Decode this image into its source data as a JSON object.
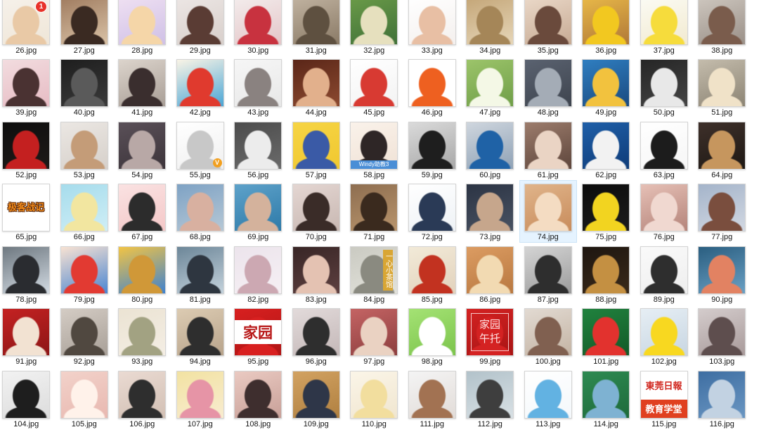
{
  "items": [
    {
      "name": "26.jpg",
      "colors": [
        "#f6f1ea",
        "#e9c9a6",
        "#efe6d8"
      ],
      "overlay": {
        "style": "badge",
        "lines": [
          "1"
        ]
      }
    },
    {
      "name": "27.jpg",
      "colors": [
        "#a07c60",
        "#3a2a22",
        "#d9c2a6"
      ]
    },
    {
      "name": "28.jpg",
      "colors": [
        "#efe0f2",
        "#f5d6a8",
        "#cfc0e6"
      ]
    },
    {
      "name": "29.jpg",
      "colors": [
        "#ece6e4",
        "#5a3c34",
        "#d8cfcb"
      ]
    },
    {
      "name": "30.jpg",
      "colors": [
        "#f3ecec",
        "#c8323f",
        "#e4c6c8"
      ]
    },
    {
      "name": "31.jpg",
      "colors": [
        "#c0b2a0",
        "#5e5040",
        "#8a7a66"
      ]
    },
    {
      "name": "32.jpg",
      "colors": [
        "#6a9a48",
        "#e6e0be",
        "#3f7038"
      ]
    },
    {
      "name": "33.jpg",
      "colors": [
        "#ffffff",
        "#e8bfa4",
        "#f4f0ee"
      ]
    },
    {
      "name": "34.jpg",
      "colors": [
        "#c4a678",
        "#a58658",
        "#e6d6b8"
      ]
    },
    {
      "name": "35.jpg",
      "colors": [
        "#ead8c8",
        "#6a4a3c",
        "#c7ab94"
      ]
    },
    {
      "name": "36.jpg",
      "colors": [
        "#e8b848",
        "#f2c820",
        "#b07838"
      ]
    },
    {
      "name": "37.jpg",
      "colors": [
        "#fbfbf4",
        "#f6dc3c",
        "#f2ead0"
      ]
    },
    {
      "name": "38.jpg",
      "colors": [
        "#cdc6be",
        "#7a5c4c",
        "#9a9088"
      ]
    },
    {
      "name": "39.jpg",
      "colors": [
        "#f2dcdf",
        "#4a3232",
        "#e7bcc4"
      ]
    },
    {
      "name": "40.jpg",
      "colors": [
        "#1e1e1e",
        "#5a5a5a",
        "#3a3a3a"
      ]
    },
    {
      "name": "41.jpg",
      "colors": [
        "#dcd4cc",
        "#3a2e2e",
        "#a89e96"
      ]
    },
    {
      "name": "42.jpg",
      "colors": [
        "#faf4e6",
        "#e03a2e",
        "#4aa6d6"
      ]
    },
    {
      "name": "43.jpg",
      "colors": [
        "#f6f6f6",
        "#8a8280",
        "#e8e8e8"
      ]
    },
    {
      "name": "44.jpg",
      "colors": [
        "#5a2618",
        "#e2b08c",
        "#8c4a30"
      ]
    },
    {
      "name": "45.jpg",
      "colors": [
        "#ffffff",
        "#d83a32",
        "#f3f3f3"
      ]
    },
    {
      "name": "46.jpg",
      "colors": [
        "#ffffff",
        "#ee6020",
        "#ffffff"
      ]
    },
    {
      "name": "47.jpg",
      "colors": [
        "#9cc46a",
        "#f4f8e6",
        "#6f9e48"
      ]
    },
    {
      "name": "48.jpg",
      "colors": [
        "#5a6270",
        "#a4acb6",
        "#3e444e"
      ]
    },
    {
      "name": "49.jpg",
      "colors": [
        "#2f7ec0",
        "#f2c23e",
        "#1a4a80"
      ]
    },
    {
      "name": "50.jpg",
      "colors": [
        "#262626",
        "#e8e8e8",
        "#444444"
      ]
    },
    {
      "name": "51.jpg",
      "colors": [
        "#c4bcac",
        "#f0e2c8",
        "#8c8474"
      ]
    },
    {
      "name": "52.jpg",
      "colors": [
        "#0e0e0e",
        "#c42020",
        "#1e1a18"
      ]
    },
    {
      "name": "53.jpg",
      "colors": [
        "#ebe7e3",
        "#c49c78",
        "#d6d0ca"
      ]
    },
    {
      "name": "54.jpg",
      "colors": [
        "#5a5058",
        "#b8a8a6",
        "#3c343a"
      ]
    },
    {
      "name": "55.jpg",
      "colors": [
        "#ffffff",
        "#c8c8c8",
        "#f0f0f0"
      ],
      "overlay": {
        "style": "badge-v",
        "lines": [
          "V"
        ]
      }
    },
    {
      "name": "56.jpg",
      "colors": [
        "#4c4c4c",
        "#ececec",
        "#6a6a6a"
      ]
    },
    {
      "name": "57.jpg",
      "colors": [
        "#f6d444",
        "#3a5aa6",
        "#f0c830"
      ]
    },
    {
      "name": "58.jpg",
      "colors": [
        "#faf2ea",
        "#2e2626",
        "#f0e2d6"
      ],
      "overlay": {
        "style": "caption",
        "lines": [
          "Windy助教3"
        ]
      }
    },
    {
      "name": "59.jpg",
      "colors": [
        "#dadada",
        "#1e1e1e",
        "#a8a8a8"
      ]
    },
    {
      "name": "60.jpg",
      "colors": [
        "#cfd6de",
        "#1f62a6",
        "#8fa2b6"
      ]
    },
    {
      "name": "61.jpg",
      "colors": [
        "#9c7c6c",
        "#ead4c4",
        "#5e463c"
      ]
    },
    {
      "name": "62.jpg",
      "colors": [
        "#1f5fa8",
        "#f2f2f2",
        "#0f3c78"
      ]
    },
    {
      "name": "63.jpg",
      "colors": [
        "#ffffff",
        "#1c1c1c",
        "#f6f6f6"
      ]
    },
    {
      "name": "64.jpg",
      "colors": [
        "#3e302a",
        "#c6965e",
        "#1e1814"
      ]
    },
    {
      "name": "65.jpg",
      "colors": [
        "#ffffff",
        "#ffffff",
        "#ffffff"
      ],
      "overlay": {
        "style": "title",
        "lines": [
          "极客战记"
        ]
      }
    },
    {
      "name": "66.jpg",
      "colors": [
        "#a6dcec",
        "#f2e6a0",
        "#cfeef6"
      ]
    },
    {
      "name": "67.jpg",
      "colors": [
        "#fae2e2",
        "#2c2c2c",
        "#f4c8c8"
      ]
    },
    {
      "name": "68.jpg",
      "colors": [
        "#7ea2c4",
        "#d8b0a0",
        "#b6c8d6"
      ]
    },
    {
      "name": "69.jpg",
      "colors": [
        "#5ea2ca",
        "#d4b29c",
        "#2e7aa8"
      ]
    },
    {
      "name": "70.jpg",
      "colors": [
        "#e4d6d2",
        "#3a2c28",
        "#c8b8b2"
      ]
    },
    {
      "name": "71.jpg",
      "colors": [
        "#8e6e50",
        "#3a2a1e",
        "#b8946c"
      ]
    },
    {
      "name": "72.jpg",
      "colors": [
        "#ffffff",
        "#2a3a56",
        "#eef2f6"
      ]
    },
    {
      "name": "73.jpg",
      "colors": [
        "#2c3444",
        "#c6a68c",
        "#485262"
      ]
    },
    {
      "name": "74.jpg",
      "colors": [
        "#e0b48a",
        "#f4dcc2",
        "#c88c5c"
      ],
      "hovered": true
    },
    {
      "name": "75.jpg",
      "colors": [
        "#0c0c0c",
        "#f2d420",
        "#1c1c1c"
      ]
    },
    {
      "name": "76.jpg",
      "colors": [
        "#e6c0b6",
        "#f0d8d0",
        "#b4847a"
      ]
    },
    {
      "name": "77.jpg",
      "colors": [
        "#a4b4ca",
        "#7a4e3e",
        "#d2d8e2"
      ]
    },
    {
      "name": "78.jpg",
      "colors": [
        "#6e7880",
        "#2a2c30",
        "#d2dae2"
      ]
    },
    {
      "name": "79.jpg",
      "colors": [
        "#f8e2d2",
        "#e23a32",
        "#4a86d2"
      ]
    },
    {
      "name": "80.jpg",
      "colors": [
        "#f2c444",
        "#d09838",
        "#3e82d0"
      ]
    },
    {
      "name": "81.jpg",
      "colors": [
        "#6c8698",
        "#2e3640",
        "#c4d2dc"
      ]
    },
    {
      "name": "82.jpg",
      "colors": [
        "#ece4ec",
        "#cca8b2",
        "#f6f0f4"
      ]
    },
    {
      "name": "83.jpg",
      "colors": [
        "#382626",
        "#e4c2b2",
        "#5e4040"
      ]
    },
    {
      "name": "84.jpg",
      "colors": [
        "#cacac2",
        "#8a8a80",
        "#e2e2da"
      ],
      "overlay": {
        "style": "vertical",
        "lines": [
          "一心小茶馆"
        ]
      }
    },
    {
      "name": "85.jpg",
      "colors": [
        "#f2ead8",
        "#c23220",
        "#e2d2bc"
      ]
    },
    {
      "name": "86.jpg",
      "colors": [
        "#dc9c62",
        "#f2dab2",
        "#b87840"
      ]
    },
    {
      "name": "87.jpg",
      "colors": [
        "#d4d4d4",
        "#2e2e2e",
        "#9c9c9c"
      ]
    },
    {
      "name": "88.jpg",
      "colors": [
        "#1e1610",
        "#c49042",
        "#3a2a1a"
      ]
    },
    {
      "name": "89.jpg",
      "colors": [
        "#fafafa",
        "#2e2e2e",
        "#eeeeee"
      ]
    },
    {
      "name": "90.jpg",
      "colors": [
        "#2a5e80",
        "#e28262",
        "#6aa0c4"
      ]
    },
    {
      "name": "91.jpg",
      "colors": [
        "#c42222",
        "#f2e2d2",
        "#8c1616"
      ]
    },
    {
      "name": "92.jpg",
      "colors": [
        "#d4ccc4",
        "#504840",
        "#a8a098"
      ]
    },
    {
      "name": "93.jpg",
      "colors": [
        "#ebe3d3",
        "#a2a282",
        "#f4eee4"
      ]
    },
    {
      "name": "94.jpg",
      "colors": [
        "#dccbb2",
        "#2e2e2e",
        "#b8a48c"
      ]
    },
    {
      "name": "95.jpg",
      "colors": [
        "#d82020",
        "#d82020",
        "#b01414"
      ],
      "overlay": {
        "style": "sign",
        "lines": [
          "家园"
        ]
      }
    },
    {
      "name": "96.jpg",
      "colors": [
        "#e2dada",
        "#2e2e2e",
        "#c4b8b8"
      ]
    },
    {
      "name": "97.jpg",
      "colors": [
        "#c46464",
        "#ead2c2",
        "#8c3e3e"
      ]
    },
    {
      "name": "98.jpg",
      "colors": [
        "#a4e274",
        "#ffffff",
        "#7cc44c"
      ]
    },
    {
      "name": "99.jpg",
      "colors": [
        "#d42222",
        "#d42222",
        "#a81414"
      ],
      "overlay": {
        "style": "sign-red",
        "lines": [
          "家园",
          "午托"
        ]
      }
    },
    {
      "name": "100.jpg",
      "colors": [
        "#e2dad2",
        "#806050",
        "#c4b4a4"
      ]
    },
    {
      "name": "101.jpg",
      "colors": [
        "#20823e",
        "#e2322e",
        "#135a28"
      ]
    },
    {
      "name": "102.jpg",
      "colors": [
        "#e6eef4",
        "#f8d820",
        "#c8d6e2"
      ]
    },
    {
      "name": "103.jpg",
      "colors": [
        "#d4cccc",
        "#5e4e4e",
        "#a89a9a"
      ]
    },
    {
      "name": "104.jpg",
      "colors": [
        "#f2f2f2",
        "#1e1e1e",
        "#dcdcdc"
      ]
    },
    {
      "name": "105.jpg",
      "colors": [
        "#f2d2ca",
        "#fff2ea",
        "#e8b8b0"
      ]
    },
    {
      "name": "106.jpg",
      "colors": [
        "#eadad2",
        "#2e2e2e",
        "#d2c0b4"
      ]
    },
    {
      "name": "107.jpg",
      "colors": [
        "#f2e2a2",
        "#e694a6",
        "#f8ecd0"
      ]
    },
    {
      "name": "108.jpg",
      "colors": [
        "#eacac2",
        "#3e2e2e",
        "#c8a098"
      ]
    },
    {
      "name": "109.jpg",
      "colors": [
        "#d2a262",
        "#2e3648",
        "#b08040"
      ]
    },
    {
      "name": "110.jpg",
      "colors": [
        "#fbf5e8",
        "#f2de9e",
        "#f0e6d0"
      ]
    },
    {
      "name": "111.jpg",
      "colors": [
        "#f4f4f4",
        "#a27252",
        "#e2dcd8"
      ]
    },
    {
      "name": "112.jpg",
      "colors": [
        "#b2c2ca",
        "#3e3e3e",
        "#d8e0e4"
      ]
    },
    {
      "name": "113.jpg",
      "colors": [
        "#ffffff",
        "#62b2e2",
        "#f4f8fb"
      ]
    },
    {
      "name": "114.jpg",
      "colors": [
        "#2e8a52",
        "#7eb2d2",
        "#1e6a3a"
      ]
    },
    {
      "name": "115.jpg",
      "colors": [
        "#ffffff",
        "#ffffff",
        "#ffffff"
      ],
      "overlay": {
        "style": "news",
        "lines": [
          "東莞日報",
          "教育学堂"
        ]
      }
    },
    {
      "name": "116.jpg",
      "colors": [
        "#3e6ea2",
        "#c2d2e2",
        "#6a96c2"
      ]
    }
  ]
}
